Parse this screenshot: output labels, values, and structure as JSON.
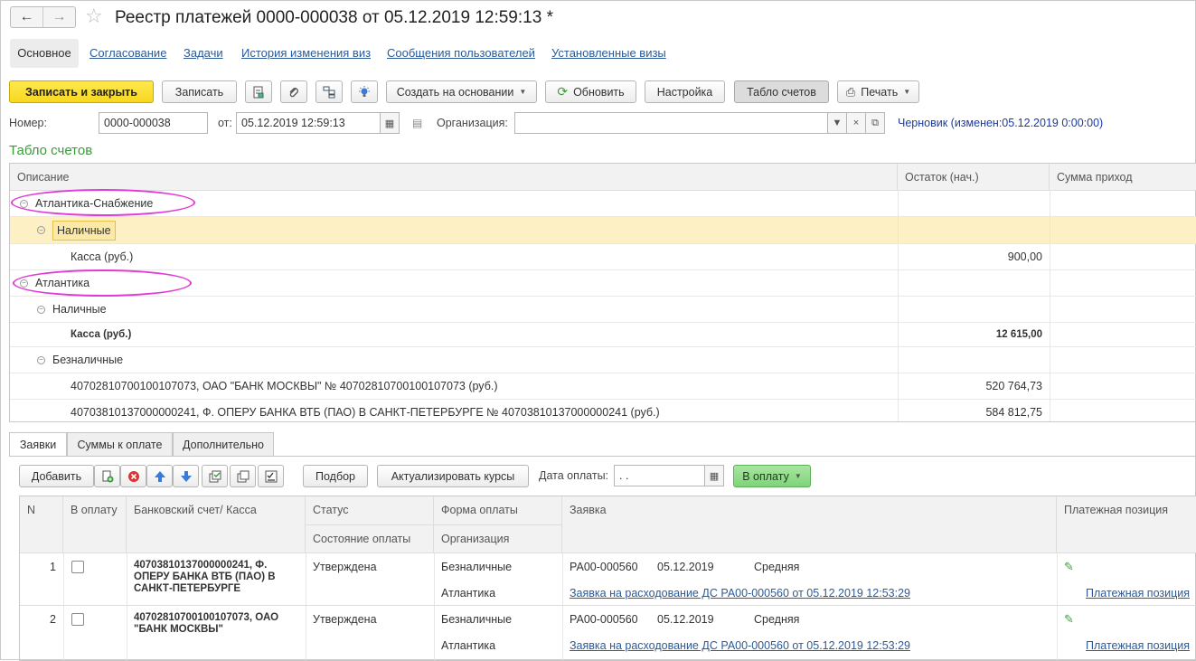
{
  "window": {
    "title": "Реестр платежей 0000-000038 от 05.12.2019 12:59:13 *"
  },
  "top_tabs": [
    "Основное",
    "Согласование",
    "Задачи",
    "История изменения виз",
    "Сообщения пользователей",
    "Установленные визы"
  ],
  "toolbar": {
    "save_close": "Записать и закрыть",
    "save": "Записать",
    "create_based": "Создать на основании",
    "refresh": "Обновить",
    "settings": "Настройка",
    "accounts_board": "Табло счетов",
    "print": "Печать"
  },
  "header_fields": {
    "number_label": "Номер:",
    "number_value": "0000-000038",
    "date_label": "от:",
    "date_value": "05.12.2019 12:59:13",
    "org_label": "Организация:",
    "org_value": "",
    "status_text": "Черновик (изменен:05.12.2019 0:00:00)"
  },
  "board": {
    "title": "Табло счетов",
    "columns": [
      "Описание",
      "Остаток (нач.)",
      "Сумма приход"
    ],
    "rows": [
      {
        "text": "Атлантика-Снабжение",
        "value": ""
      },
      {
        "text": "Наличные",
        "value": ""
      },
      {
        "text": "Касса (руб.)",
        "value": "900,00"
      },
      {
        "text": "Атлантика",
        "value": ""
      },
      {
        "text": "Наличные",
        "value": ""
      },
      {
        "text": "Касса (руб.)",
        "value": "12 615,00"
      },
      {
        "text": "Безналичные",
        "value": ""
      },
      {
        "text": "40702810700100107073, ОАО \"БАНК МОСКВЫ\" № 40702810700100107073 (руб.)",
        "value": "520 764,73"
      },
      {
        "text": "40703810137000000241, Ф. ОПЕРУ БАНКА ВТБ (ПАО) В САНКТ-ПЕТЕРБУРГЕ № 40703810137000000241 (руб.)",
        "value": "584 812,75"
      }
    ]
  },
  "bottom_tabs": [
    "Заявки",
    "Суммы к оплате",
    "Дополнительно"
  ],
  "bottom_toolbar": {
    "add": "Добавить",
    "pick": "Подбор",
    "update_rates": "Актуализировать курсы",
    "pay_date_label": "Дата оплаты:",
    "pay_date_value": " .  .",
    "to_payment": "В оплату"
  },
  "requests": {
    "columns": {
      "n": "N",
      "to_pay": "В оплату",
      "account": "Банковский счет/ Касса",
      "status": "Статус",
      "pay_state": "Состояние оплаты",
      "pay_form": "Форма оплаты",
      "org": "Организация",
      "request": "Заявка",
      "pay_position": "Платежная позиция"
    },
    "rows": [
      {
        "n": "1",
        "account": "40703810137000000241, Ф. ОПЕРУ БАНКА ВТБ (ПАО) В САНКТ-ПЕТЕРБУРГЕ",
        "status": "Утверждена",
        "pay_form": "Безналичные",
        "org": "Атлантика",
        "req_num": "РА00-000560",
        "req_date": "05.12.2019",
        "priority": "Средняя",
        "req_link": "Заявка на расходование ДС РА00-000560 от 05.12.2019 12:53:29",
        "pos_link": "Платежная позиция"
      },
      {
        "n": "2",
        "account": "40702810700100107073, ОАО \"БАНК МОСКВЫ\"",
        "status": "Утверждена",
        "pay_form": "Безналичные",
        "org": "Атлантика",
        "req_num": "РА00-000560",
        "req_date": "05.12.2019",
        "priority": "Средняя",
        "req_link": "Заявка на расходование ДС РА00-000560 от 05.12.2019 12:53:29",
        "pos_link": "Платежная позиция"
      }
    ]
  }
}
